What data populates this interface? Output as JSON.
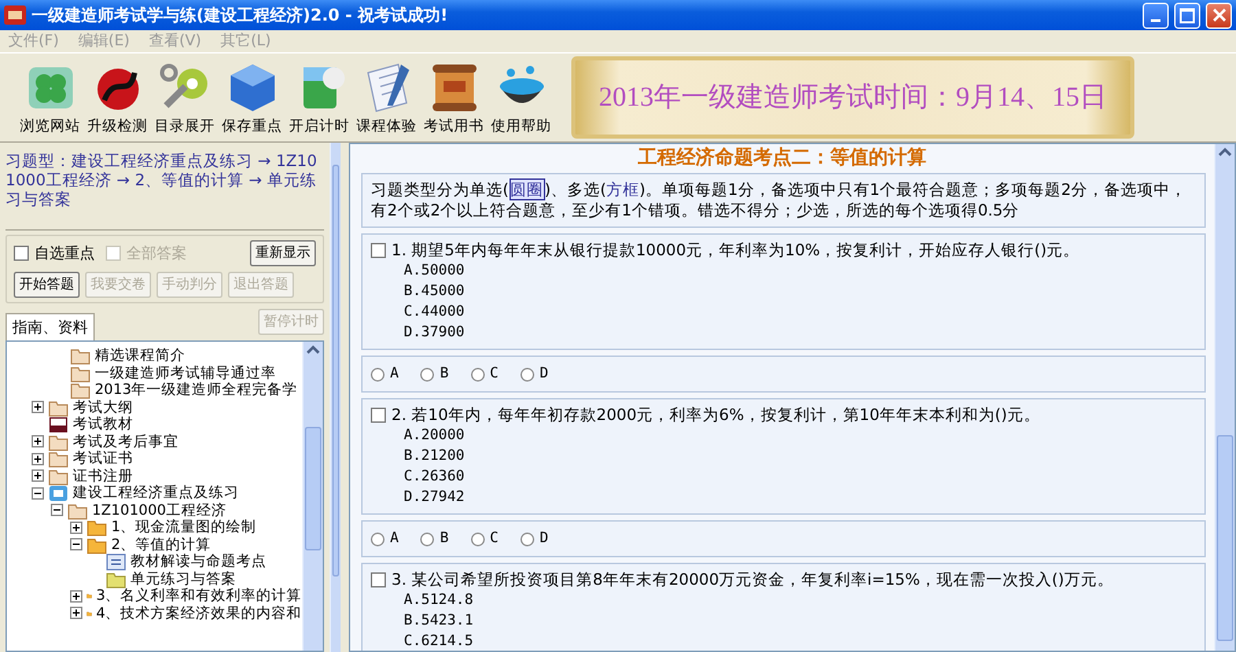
{
  "window": {
    "title": "一级建造师考试学与练(建设工程经济)2.0 - 祝考试成功!"
  },
  "menu": [
    {
      "label": "文件(F)",
      "disabled": true
    },
    {
      "label": "编辑(E)",
      "disabled": true
    },
    {
      "label": "查看(V)",
      "disabled": true
    },
    {
      "label": "其它(L)",
      "disabled": true
    }
  ],
  "toolbar": [
    {
      "label": "浏览网站",
      "kind": "clover"
    },
    {
      "label": "升级检测",
      "kind": "swirl"
    },
    {
      "label": "目录展开",
      "kind": "gear"
    },
    {
      "label": "保存重点",
      "kind": "cube"
    },
    {
      "label": "开启计时",
      "kind": "box"
    },
    {
      "label": "课程体验",
      "kind": "notebook"
    },
    {
      "label": "考试用书",
      "kind": "scroll"
    },
    {
      "label": "使用帮助",
      "kind": "bowl"
    }
  ],
  "banner": {
    "text": "2013年一级建造师考试时间：9月14、15日"
  },
  "breadcrumb": "习题型：建设工程经济重点及练习 → 1Z101000工程经济 → 2、等值的计算 → 单元练习与答案",
  "checkboxes": [
    {
      "label": "自选重点",
      "checked": false,
      "disabled": false
    },
    {
      "label": "全部答案",
      "checked": false,
      "disabled": true
    }
  ],
  "redisplay_button": {
    "label": "重新显示",
    "disabled": false
  },
  "buttons": [
    {
      "label": "开始答题",
      "disabled": false
    },
    {
      "label": "我要交卷",
      "disabled": true
    },
    {
      "label": "手动判分",
      "disabled": true
    },
    {
      "label": "退出答题",
      "disabled": true
    }
  ],
  "tabs": [
    {
      "label": "指南、资料",
      "selected": true
    }
  ],
  "timer_button": {
    "label": "暂停计时",
    "disabled": true
  },
  "tree": {
    "partial_children": [
      {
        "label": "精选课程简介",
        "kind": "folder"
      },
      {
        "label": "一级建造师考试辅导通过率",
        "kind": "folder"
      },
      {
        "label": "2013年一级建造师全程完备学",
        "kind": "folder"
      }
    ],
    "items": [
      {
        "label": "考试大纲",
        "kind": "folder",
        "expanded": false
      },
      {
        "label": "考试教材",
        "kind": "book"
      },
      {
        "label": "考试及考后事宜",
        "kind": "folder",
        "expanded": false
      },
      {
        "label": "考试证书",
        "kind": "folder",
        "expanded": false
      },
      {
        "label": "证书注册",
        "kind": "folder",
        "expanded": false
      },
      {
        "label": "建设工程经济重点及练习",
        "kind": "section",
        "expanded": true,
        "children": [
          {
            "label": "1Z101000工程经济",
            "kind": "folder",
            "expanded": true,
            "children": [
              {
                "label": "1、现金流量图的绘制",
                "kind": "open-folder",
                "expanded": false
              },
              {
                "label": "2、等值的计算",
                "kind": "open-folder",
                "expanded": true,
                "children": [
                  {
                    "label": "教材解读与命题考点",
                    "kind": "document"
                  },
                  {
                    "label": "单元练习与答案",
                    "kind": "exercise"
                  }
                ]
              },
              {
                "label": "3、名义利率和有效利率的计算",
                "kind": "open-folder",
                "expanded": false
              },
              {
                "label": "4、技术方案经济效果的内容和",
                "kind": "open-folder",
                "expanded": false
              }
            ]
          }
        ]
      }
    ]
  },
  "content": {
    "heading": "工程经济命题考点二：等值的计算",
    "intro": [
      {
        "text": "习题类型分为单选(",
        "kind": "plain"
      },
      {
        "text": "圆圈",
        "kind": "boxed"
      },
      {
        "text": ")、多选(",
        "kind": "plain"
      },
      {
        "text": "方框",
        "kind": "colored"
      },
      {
        "text": ")。单项每题1分，备选项中只有1个最符合题意；多项每题2分，备选项中，有2个或2个以上符合题意，至少有1个错项。错选不得分；少选，所选的每个选项得0.5分",
        "kind": "plain"
      }
    ],
    "questions": [
      {
        "text": "1. 期望5年内每年年末从银行提款10000元，年利率为10%，按复利计，开始应存人银行()元。",
        "checked": false,
        "options": [
          "A.50000",
          "B.45000",
          "C.44000",
          "D.37900"
        ],
        "answers": [
          {
            "label": "A",
            "selected": false
          },
          {
            "label": "B",
            "selected": false
          },
          {
            "label": "C",
            "selected": false
          },
          {
            "label": "D",
            "selected": false
          }
        ]
      },
      {
        "text": "2. 若10年内，每年年初存款2000元，利率为6%，按复利计，第10年年末本利和为()元。",
        "checked": false,
        "options": [
          "A.20000",
          "B.21200",
          "C.26360",
          "D.27942"
        ],
        "answers": [
          {
            "label": "A",
            "selected": false
          },
          {
            "label": "B",
            "selected": false
          },
          {
            "label": "C",
            "selected": false
          },
          {
            "label": "D",
            "selected": false
          }
        ]
      },
      {
        "text": "3. 某公司希望所投资项目第8年年末有20000万元资金，年复利率i=15%，现在需一次投入()万元。",
        "checked": false,
        "options": [
          "A.5124.8",
          "B.5423.1",
          "C.6214.5"
        ]
      }
    ]
  }
}
